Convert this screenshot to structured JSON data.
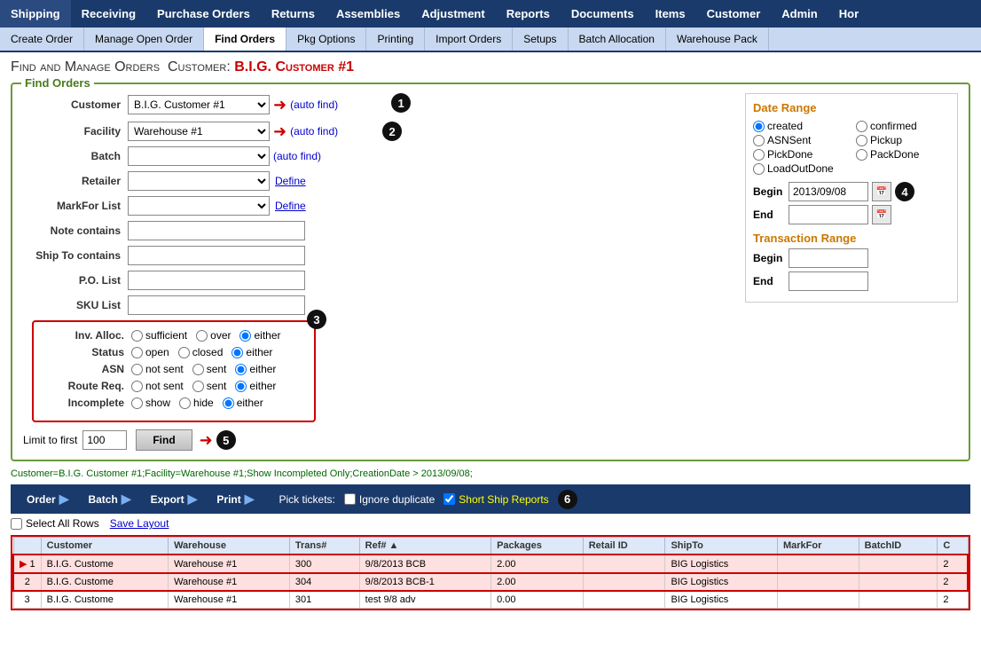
{
  "topNav": {
    "items": [
      {
        "label": "Shipping",
        "active": true
      },
      {
        "label": "Receiving"
      },
      {
        "label": "Purchase Orders"
      },
      {
        "label": "Returns"
      },
      {
        "label": "Assemblies"
      },
      {
        "label": "Adjustment"
      },
      {
        "label": "Reports"
      },
      {
        "label": "Documents"
      },
      {
        "label": "Items"
      },
      {
        "label": "Customer"
      },
      {
        "label": "Admin"
      },
      {
        "label": "Hor"
      }
    ]
  },
  "subNav": {
    "items": [
      {
        "label": "Create Order"
      },
      {
        "label": "Manage Open Order"
      },
      {
        "label": "Find Orders",
        "active": true
      },
      {
        "label": "Pkg Options"
      },
      {
        "label": "Printing"
      },
      {
        "label": "Import Orders"
      },
      {
        "label": "Setups"
      },
      {
        "label": "Batch Allocation"
      },
      {
        "label": "Warehouse Pack"
      }
    ]
  },
  "pageTitle": "Find and Manage Orders",
  "customerName": "B.I.G. Customer #1",
  "findOrders": {
    "sectionLabel": "Find Orders",
    "customer": {
      "label": "Customer",
      "value": "B.I.G. Customer #1",
      "autoFind": "(auto find)"
    },
    "facility": {
      "label": "Facility",
      "value": "Warehouse #1",
      "autoFind": "(auto find)"
    },
    "batch": {
      "label": "Batch",
      "autoFind": "(auto find)"
    },
    "retailer": {
      "label": "Retailer",
      "define": "Define"
    },
    "markForList": {
      "label": "MarkFor List",
      "define": "Define"
    },
    "noteContains": {
      "label": "Note contains"
    },
    "shipToContains": {
      "label": "Ship To contains"
    },
    "poList": {
      "label": "P.O. List"
    },
    "skuList": {
      "label": "SKU List"
    },
    "limitLabel": "Limit to first",
    "limitValue": "100",
    "findButton": "Find"
  },
  "filterBox": {
    "invAlloc": {
      "label": "Inv. Alloc.",
      "options": [
        "sufficient",
        "over",
        "either"
      ],
      "selected": "either"
    },
    "status": {
      "label": "Status",
      "options": [
        "open",
        "closed",
        "either"
      ],
      "selected": "either"
    },
    "asn": {
      "label": "ASN",
      "options": [
        "not sent",
        "sent",
        "either"
      ],
      "selected": "either"
    },
    "routeReq": {
      "label": "Route Req.",
      "options": [
        "not sent",
        "sent",
        "either"
      ],
      "selected": "either"
    },
    "incomplete": {
      "label": "Incomplete",
      "options": [
        "show",
        "hide",
        "either"
      ],
      "selected": "either"
    }
  },
  "dateRange": {
    "title": "Date Range",
    "options": [
      {
        "label": "created",
        "selected": true
      },
      {
        "label": "confirmed"
      },
      {
        "label": "ASNSent"
      },
      {
        "label": "Pickup"
      },
      {
        "label": "PickDone"
      },
      {
        "label": "PackDone"
      },
      {
        "label": "LoadOutDone"
      }
    ],
    "beginLabel": "Begin",
    "beginValue": "2013/09/08",
    "endLabel": "End",
    "endValue": ""
  },
  "transactionRange": {
    "title": "Transaction Range",
    "beginLabel": "Begin",
    "endLabel": "End",
    "beginValue": "",
    "endValue": ""
  },
  "queryString": "Customer=B.I.G. Customer #1;Facility=Warehouse #1;Show Incompleted Only;CreationDate > 2013/09/08;",
  "resultsToolbar": {
    "buttons": [
      {
        "label": "Order"
      },
      {
        "label": "Batch"
      },
      {
        "label": "Export"
      },
      {
        "label": "Print"
      }
    ],
    "pickTickets": "Pick tickets:",
    "ignoreDuplicate": "Ignore duplicate",
    "shortShipReports": "Short Ship Reports"
  },
  "tableActions": {
    "selectAll": "Select All Rows",
    "saveLayout": "Save Layout"
  },
  "tableHeaders": [
    "",
    "Customer",
    "Warehouse",
    "Trans#",
    "Ref# ▲",
    "Packages",
    "Retail ID",
    "ShipTo",
    "MarkFor",
    "BatchID",
    "C"
  ],
  "tableRows": [
    {
      "num": "1",
      "customer": "B.I.G. Custome",
      "warehouse": "Warehouse #1",
      "trans": "300",
      "ref": "9/8/2013 BCB",
      "packages": "2.00",
      "retailId": "",
      "shipTo": "BIG Logistics",
      "markFor": "",
      "batchId": "",
      "c": "2",
      "selected": true
    },
    {
      "num": "2",
      "customer": "B.I.G. Custome",
      "warehouse": "Warehouse #1",
      "trans": "304",
      "ref": "9/8/2013 BCB-1",
      "packages": "2.00",
      "retailId": "",
      "shipTo": "BIG Logistics",
      "markFor": "",
      "batchId": "",
      "c": "2",
      "selected": true
    },
    {
      "num": "3",
      "customer": "B.I.G. Custome",
      "warehouse": "Warehouse #1",
      "trans": "301",
      "ref": "test 9/8 adv",
      "packages": "0.00",
      "retailId": "",
      "shipTo": "BIG Logistics",
      "markFor": "",
      "batchId": "",
      "c": "2",
      "selected": false
    }
  ]
}
